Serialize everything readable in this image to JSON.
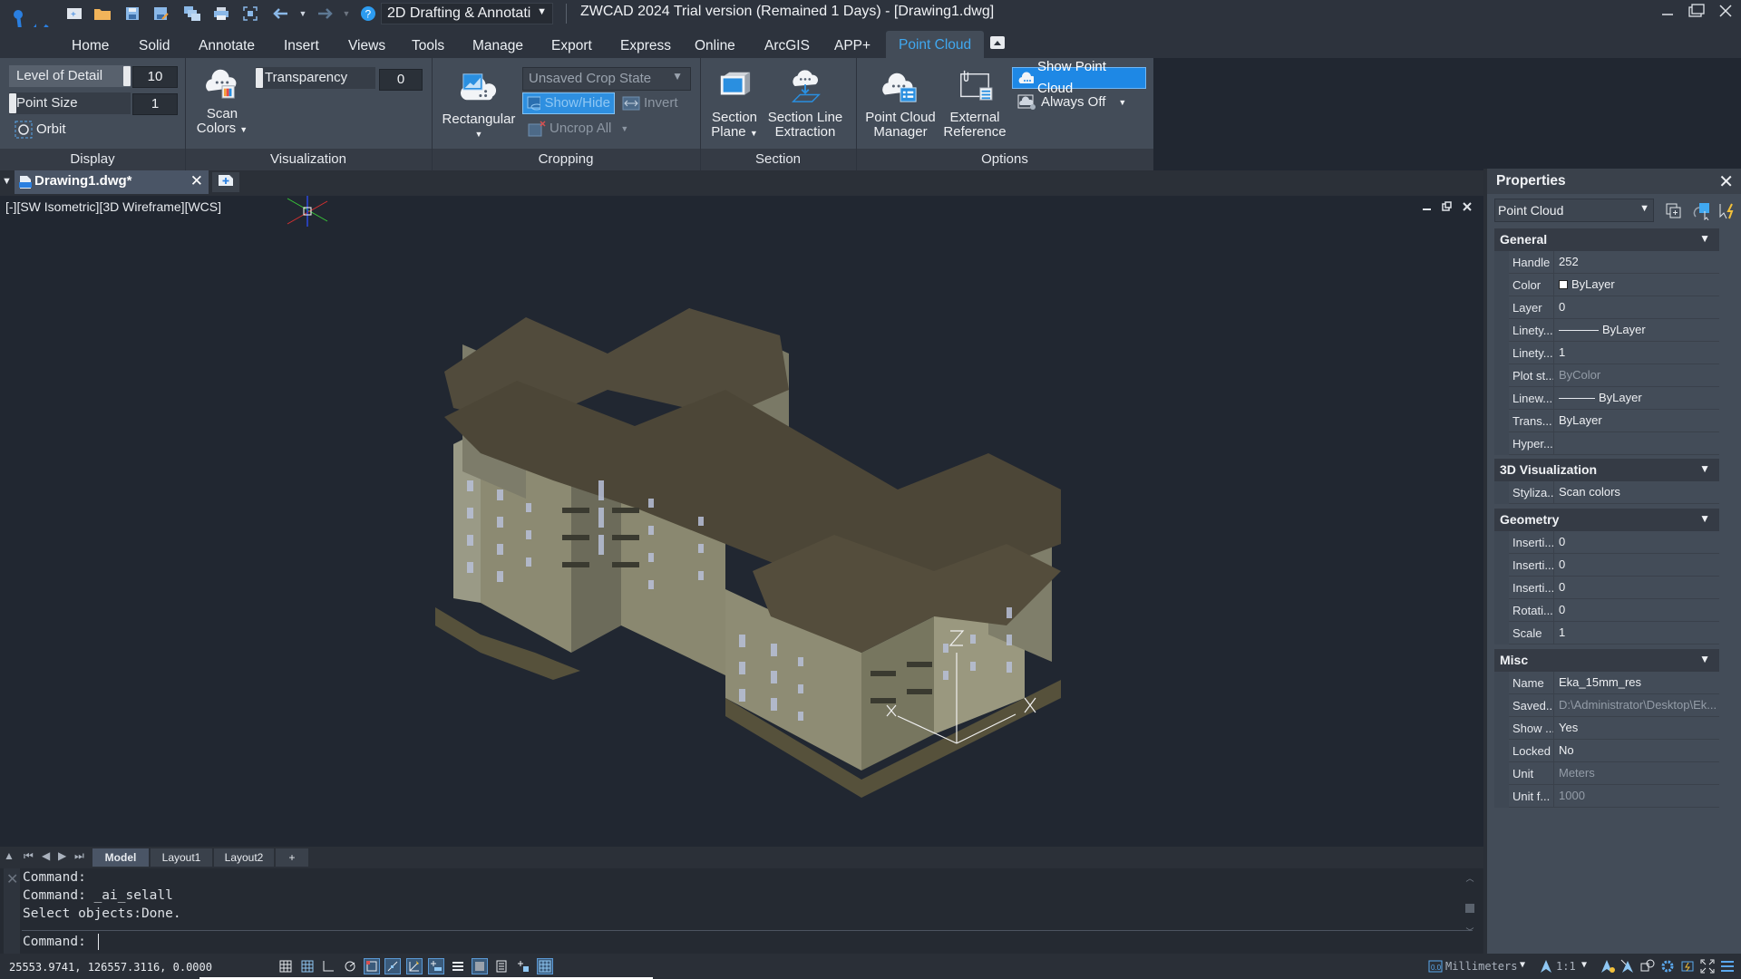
{
  "titlebar": {
    "title": "ZWCAD 2024 Trial version (Remained 1 Days) - [Drawing1.dwg]",
    "workspace": "2D Drafting & Annotati",
    "quick_access": [
      "new-icon",
      "open-icon",
      "save-icon",
      "save-as-icon",
      "batch-plot-icon",
      "print-icon",
      "zoom-extents-icon",
      "undo-icon",
      "redo-icon",
      "help-icon"
    ]
  },
  "menu": {
    "tabs": [
      "Home",
      "Solid",
      "Annotate",
      "Insert",
      "Views",
      "Tools",
      "Manage",
      "Export",
      "Express",
      "Online",
      "ArcGIS",
      "APP+",
      "Point Cloud"
    ],
    "active": "Point Cloud"
  },
  "ribbon": {
    "display": {
      "label": "Display",
      "level_of_detail": {
        "label": "Level of Detail",
        "value": "10",
        "fraction": 1.0
      },
      "point_size": {
        "label": "Point Size",
        "value": "1",
        "fraction": 0.0
      },
      "orbit": "Orbit"
    },
    "visualization": {
      "label": "Visualization",
      "scan_colors": "Scan\nColors",
      "scan_colors_l1": "Scan",
      "scan_colors_l2": "Colors",
      "transparency": {
        "label": "Transparency",
        "value": "0",
        "fraction": 0.0
      }
    },
    "cropping": {
      "label": "Cropping",
      "rectangular": "Rectangular",
      "crop_state": "Unsaved Crop State",
      "show_hide": "Show/Hide",
      "invert": "Invert",
      "uncrop_all": "Uncrop All"
    },
    "section": {
      "label": "Section",
      "section_plane_l1": "Section",
      "section_plane_l2": "Plane",
      "section_line_l1": "Section Line",
      "section_line_l2": "Extraction"
    },
    "options": {
      "label": "Options",
      "manager_l1": "Point Cloud",
      "manager_l2": "Manager",
      "xref_l1": "External",
      "xref_l2": "Reference",
      "show_point_cloud": "Show Point Cloud",
      "always_off": "Always Off"
    }
  },
  "document": {
    "tab": "Drawing1.dwg*",
    "viewport_label": "[-][SW Isometric][3D Wireframe][WCS]"
  },
  "layout_tabs": [
    "Model",
    "Layout1",
    "Layout2",
    "+"
  ],
  "active_layout": "Model",
  "command": {
    "history": [
      "Command:",
      "Command: _ai_selall",
      "Select objects:Done."
    ],
    "prompt": "Command:"
  },
  "statusbar": {
    "coords": "25553.9741, 126557.3116, 0.0000",
    "units": "Millimeters",
    "scale": "1:1"
  },
  "properties": {
    "title": "Properties",
    "object_type": "Point Cloud",
    "sections": {
      "general": {
        "title": "General",
        "rows": [
          {
            "key": "Handle",
            "value": "252"
          },
          {
            "key": "Color",
            "value": "ByLayer"
          },
          {
            "key": "Layer",
            "value": "0"
          },
          {
            "key": "Linety...",
            "value": "ByLayer"
          },
          {
            "key": "Linety...",
            "value": "1"
          },
          {
            "key": "Plot st...",
            "value": "ByColor"
          },
          {
            "key": "Linew...",
            "value": "ByLayer"
          },
          {
            "key": "Trans...",
            "value": "ByLayer"
          },
          {
            "key": "Hyper...",
            "value": ""
          }
        ]
      },
      "visualization": {
        "title": "3D Visualization",
        "rows": [
          {
            "key": "Styliza...",
            "value": "Scan colors"
          }
        ]
      },
      "geometry": {
        "title": "Geometry",
        "rows": [
          {
            "key": "Inserti...",
            "value": "0"
          },
          {
            "key": "Inserti...",
            "value": "0"
          },
          {
            "key": "Inserti...",
            "value": "0"
          },
          {
            "key": "Rotati...",
            "value": "0"
          },
          {
            "key": "Scale",
            "value": "1"
          }
        ]
      },
      "misc": {
        "title": "Misc",
        "rows": [
          {
            "key": "Name",
            "value": "Eka_15mm_res"
          },
          {
            "key": "Saved...",
            "value": "D:\\Administrator\\Desktop\\Ek..."
          },
          {
            "key": "Show ...",
            "value": "Yes"
          },
          {
            "key": "Locked",
            "value": "No"
          },
          {
            "key": "Unit",
            "value": "Meters"
          },
          {
            "key": "Unit f...",
            "value": "1000"
          }
        ]
      }
    }
  },
  "colors": {
    "accent": "#1e88e5",
    "active_tab_text": "#40a8f0",
    "background": "#212731",
    "panel": "#434c58"
  }
}
